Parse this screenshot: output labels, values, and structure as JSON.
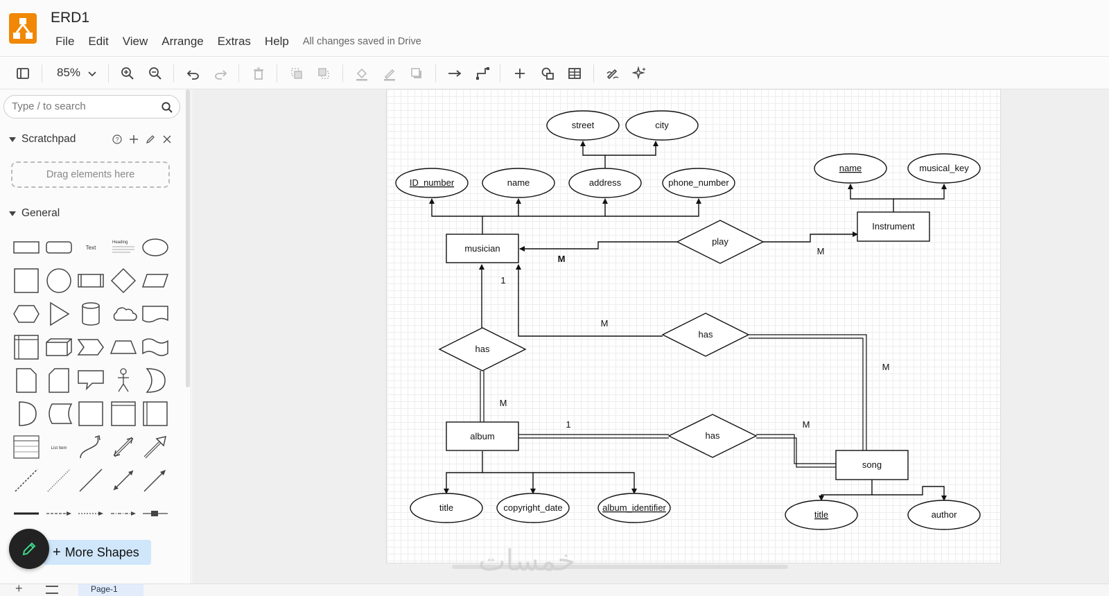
{
  "app": {
    "title": "ERD1",
    "menu": [
      "File",
      "Edit",
      "View",
      "Arrange",
      "Extras",
      "Help"
    ],
    "save_status": "All changes saved in Drive"
  },
  "toolbar": {
    "zoom": "85%",
    "tools": [
      "format-panel",
      "zoom-in",
      "zoom-out",
      "undo",
      "redo",
      "delete",
      "to-front",
      "to-back",
      "fill-color",
      "line-color",
      "shadow",
      "connection",
      "waypoints",
      "insert",
      "shapes",
      "table",
      "freehand",
      "ai-generate"
    ]
  },
  "sidebar": {
    "search_placeholder": "Type / to search",
    "scratchpad": {
      "title": "Scratchpad",
      "drop_hint": "Drag elements here"
    },
    "general": {
      "title": "General",
      "text_shape": "Text",
      "heading_shape": "Heading",
      "list_item_shape": "List Item"
    },
    "more_shapes": "More Shapes"
  },
  "diagram": {
    "entities": [
      {
        "id": "musician",
        "label": "musician"
      },
      {
        "id": "instrument",
        "label": "Instrument"
      },
      {
        "id": "album",
        "label": "album"
      },
      {
        "id": "song",
        "label": "song"
      }
    ],
    "relationships": [
      {
        "id": "play",
        "label": "play"
      },
      {
        "id": "has_musician_album",
        "label": "has"
      },
      {
        "id": "has_musician_song",
        "label": "has"
      },
      {
        "id": "has_album_song",
        "label": "has"
      }
    ],
    "attributes": [
      {
        "id": "street",
        "label": "street",
        "key": false
      },
      {
        "id": "city",
        "label": "city",
        "key": false
      },
      {
        "id": "id_number",
        "label": "ID_number",
        "key": true
      },
      {
        "id": "m_name",
        "label": "name",
        "key": false
      },
      {
        "id": "address",
        "label": "address",
        "key": false
      },
      {
        "id": "phone_number",
        "label": "phone_number",
        "key": false
      },
      {
        "id": "i_name",
        "label": "name",
        "key": true
      },
      {
        "id": "musical_key",
        "label": "musical_key",
        "key": false
      },
      {
        "id": "a_title",
        "label": "title",
        "key": false
      },
      {
        "id": "copyright_date",
        "label": "copyright_date",
        "key": false
      },
      {
        "id": "album_identifier",
        "label": "album_identifier",
        "key": true
      },
      {
        "id": "s_title",
        "label": "title",
        "key": true
      },
      {
        "id": "author",
        "label": "author",
        "key": false
      }
    ],
    "cardinalities": [
      "M",
      "M",
      "1",
      "M",
      "M",
      "M",
      "1",
      "M"
    ]
  },
  "footer": {
    "page_tab": "Page-1"
  },
  "watermark": "خمسات"
}
